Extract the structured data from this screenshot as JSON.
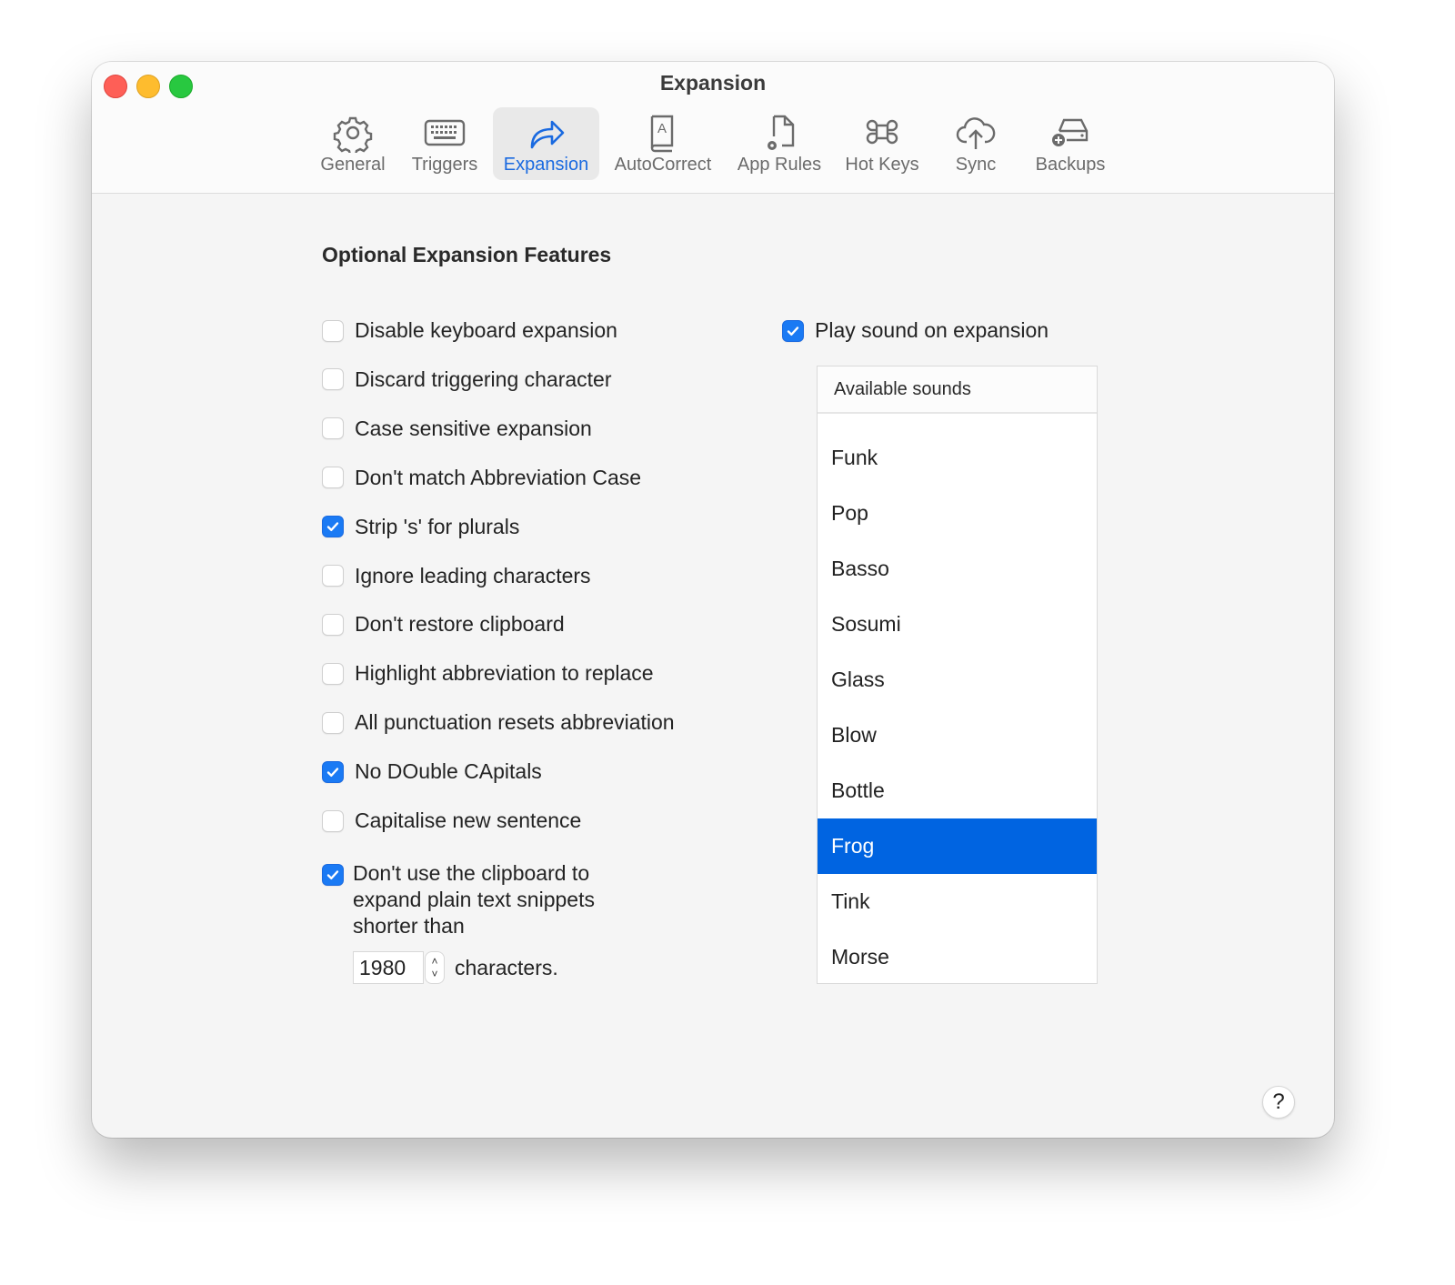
{
  "window": {
    "title": "Expansion"
  },
  "toolbar": {
    "items": [
      {
        "label": "General",
        "icon": "gear-icon",
        "active": false
      },
      {
        "label": "Triggers",
        "icon": "keyboard-icon",
        "active": false
      },
      {
        "label": "Expansion",
        "icon": "share-arrow-icon",
        "active": true
      },
      {
        "label": "AutoCorrect",
        "icon": "dictionary-book-icon",
        "active": false
      },
      {
        "label": "App Rules",
        "icon": "document-gear-icon",
        "active": false
      },
      {
        "label": "Hot Keys",
        "icon": "command-key-icon",
        "active": false
      },
      {
        "label": "Sync",
        "icon": "cloud-upload-icon",
        "active": false
      },
      {
        "label": "Backups",
        "icon": "drive-add-icon",
        "active": false
      }
    ]
  },
  "main": {
    "section_title": "Optional Expansion Features",
    "options": [
      {
        "label": "Disable keyboard expansion",
        "checked": false
      },
      {
        "label": "Discard triggering character",
        "checked": false
      },
      {
        "label": "Case sensitive expansion",
        "checked": false
      },
      {
        "label": "Don't match Abbreviation Case",
        "checked": false
      },
      {
        "label": "Strip 's' for plurals",
        "checked": true
      },
      {
        "label": "Ignore leading characters",
        "checked": false
      },
      {
        "label": "Don't restore clipboard",
        "checked": false
      },
      {
        "label": "Highlight abbreviation to replace",
        "checked": false
      },
      {
        "label": "All punctuation resets abbreviation",
        "checked": false
      },
      {
        "label": "No DOuble CApitals",
        "checked": true
      },
      {
        "label": "Capitalise new sentence",
        "checked": false
      }
    ],
    "clipboard_option": {
      "label": "Don't use the clipboard to expand plain text snippets shorter than",
      "checked": true,
      "value": "1980",
      "suffix": "characters."
    },
    "play_sound": {
      "label": "Play sound on expansion",
      "checked": true
    },
    "sounds": {
      "header": "Available sounds",
      "items": [
        "Funk",
        "Pop",
        "Basso",
        "Sosumi",
        "Glass",
        "Blow",
        "Bottle",
        "Frog",
        "Tink",
        "Morse"
      ],
      "selected": "Frog"
    },
    "help_label": "?"
  },
  "colors": {
    "accent": "#1a7af4",
    "selection": "#0064e1"
  }
}
